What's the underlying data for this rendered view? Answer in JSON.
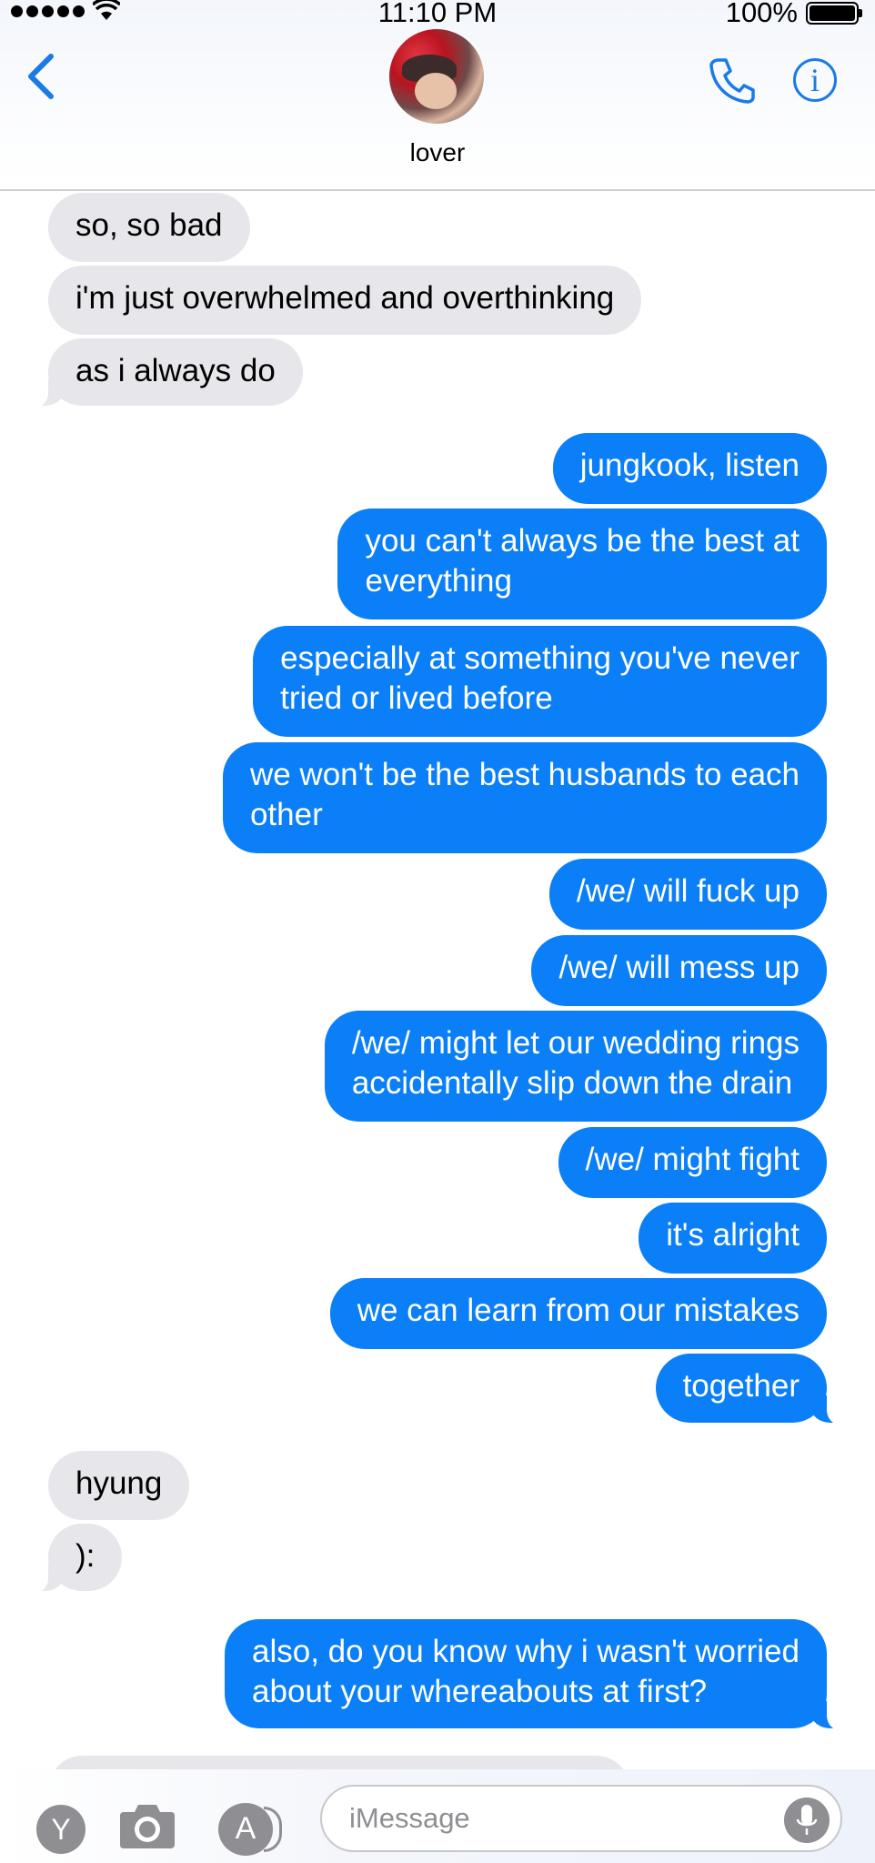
{
  "status_bar": {
    "time": "11:10 PM",
    "battery": "100%"
  },
  "header": {
    "contact_name": "lover"
  },
  "messages": [
    {
      "dir": "in",
      "text": "so, so bad",
      "top": 0
    },
    {
      "dir": "in",
      "text": "i'm just overwhelmed and overthinking"
    },
    {
      "dir": "in",
      "text": "as i always do"
    },
    {
      "dir": "out",
      "text": "jungkook, listen"
    },
    {
      "dir": "out",
      "text": "you can't always be the best at\neverything"
    },
    {
      "dir": "out",
      "text": "especially at something you've never\ntried or lived before"
    },
    {
      "dir": "out",
      "text": "we won't be the best husbands to each\nother"
    },
    {
      "dir": "out",
      "text": "/we/ will fuck up"
    },
    {
      "dir": "out",
      "text": "/we/ will mess up"
    },
    {
      "dir": "out",
      "text": "/we/ might let our wedding rings\naccidentally slip down the drain"
    },
    {
      "dir": "out",
      "text": "/we/ might fight"
    },
    {
      "dir": "out",
      "text": "it's alright"
    },
    {
      "dir": "out",
      "text": "we can learn from our mistakes"
    },
    {
      "dir": "out",
      "text": "together"
    },
    {
      "dir": "in",
      "text": "hyung"
    },
    {
      "dir": "in",
      "text": "):"
    },
    {
      "dir": "out",
      "text": "also, do you know why i wasn't worried\nabout your whereabouts at first?"
    }
  ],
  "compose": {
    "placeholder": "iMessage",
    "y_button_label": "Y",
    "apps_button_label": "A"
  },
  "icons": {
    "back": "chevron-left-icon",
    "phone": "phone-icon",
    "info": "info-icon",
    "camera": "camera-icon",
    "appstore": "app-store-icon",
    "mic": "microphone-icon"
  },
  "colors": {
    "accent": "#1a7be6",
    "outgoing_bubble": "#0b7ff7",
    "incoming_bubble": "#e6e6eb"
  }
}
